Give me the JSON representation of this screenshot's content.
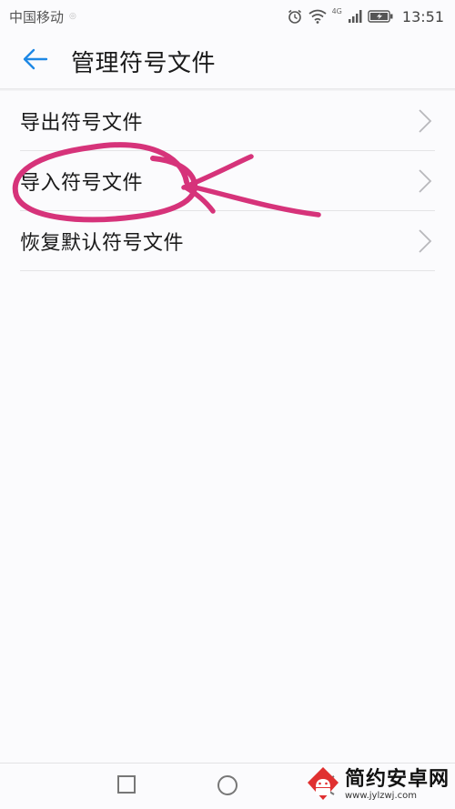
{
  "status_bar": {
    "carrier": "中国移动",
    "network": "4G",
    "time": "13:51"
  },
  "app_bar": {
    "title": "管理符号文件",
    "back_icon": "arrow-left-icon",
    "accent_color": "#1e88e5"
  },
  "menu": {
    "items": [
      {
        "label": "导出符号文件",
        "icon": "chevron-right-icon"
      },
      {
        "label": "导入符号文件",
        "icon": "chevron-right-icon"
      },
      {
        "label": "恢复默认符号文件",
        "icon": "chevron-right-icon"
      }
    ]
  },
  "annotation": {
    "color": "#d6337a",
    "description_icon": "circle-and-arrow-annotation"
  },
  "nav_bar": {
    "recent_icon": "square-icon",
    "home_icon": "circle-icon",
    "back_icon": "triangle-left-icon"
  },
  "watermark": {
    "title": "简约安卓网",
    "url": "www.jylzwj.com",
    "logo_icon": "android-logo-icon"
  }
}
